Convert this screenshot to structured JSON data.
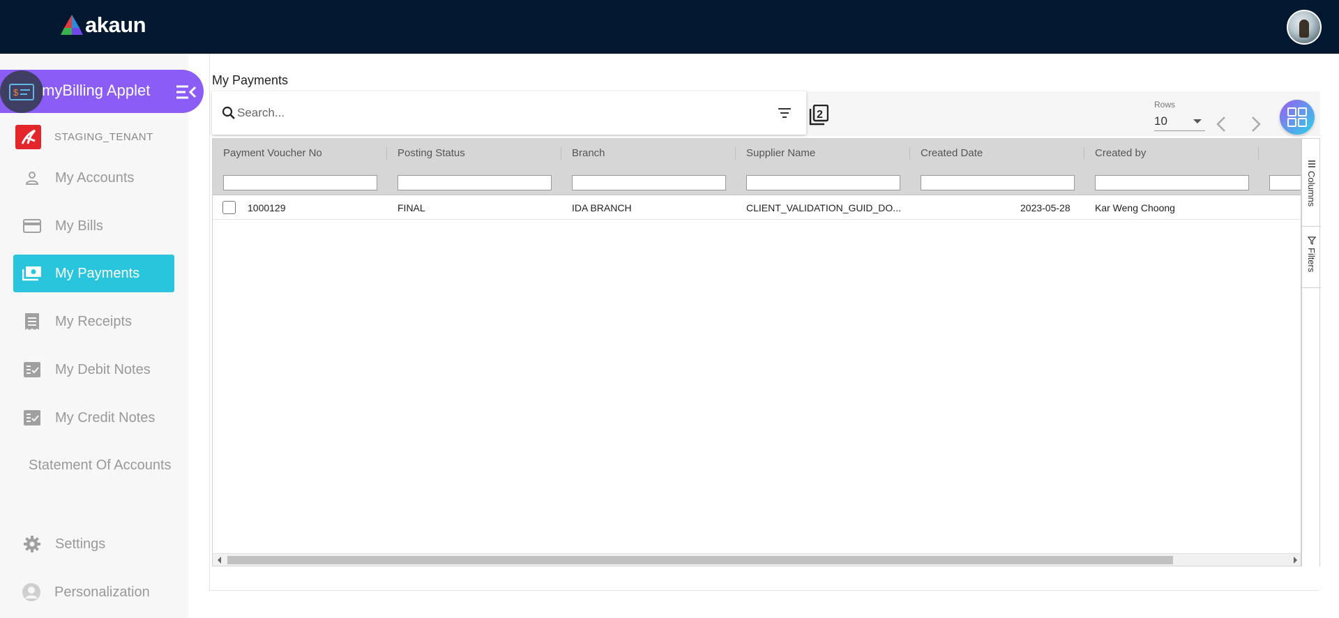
{
  "app": {
    "brand": "akaun"
  },
  "sidebar": {
    "applet_title": "myBilling Applet",
    "tenant": "STAGING_TENANT",
    "items": [
      {
        "label": "My Accounts",
        "icon": "person-icon",
        "active": false
      },
      {
        "label": "My Bills",
        "icon": "credit-card-icon",
        "active": false
      },
      {
        "label": "My Payments",
        "icon": "payments-icon",
        "active": true
      },
      {
        "label": "My Receipts",
        "icon": "receipt-icon",
        "active": false
      },
      {
        "label": "My Debit Notes",
        "icon": "checklist-icon",
        "active": false
      },
      {
        "label": "My Credit Notes",
        "icon": "checklist-icon",
        "active": false
      }
    ],
    "statement": "Statement Of Accounts",
    "settings": "Settings",
    "personalization": "Personalization"
  },
  "main": {
    "title": "My Payments",
    "search": {
      "placeholder": "Search...",
      "value": ""
    },
    "copy_badge": "2",
    "rows": {
      "label": "Rows",
      "value": "10"
    }
  },
  "grid": {
    "columns": [
      "Payment Voucher No",
      "Posting Status",
      "Branch",
      "Supplier Name",
      "Created Date",
      "Created by"
    ],
    "rows": [
      {
        "payment_voucher_no": "1000129",
        "posting_status": "FINAL",
        "branch": "IDA BRANCH",
        "supplier_name": "CLIENT_VALIDATION_GUID_DO...",
        "created_date": "2023-05-28",
        "created_by": "Kar Weng Choong"
      }
    ],
    "side_tabs": [
      "Columns",
      "Filters"
    ]
  },
  "colors": {
    "topbar": "#011830",
    "applet_bar": "#8b5cf6",
    "active_nav": "#29c5dd",
    "tenant_logo": "#e3262c"
  }
}
